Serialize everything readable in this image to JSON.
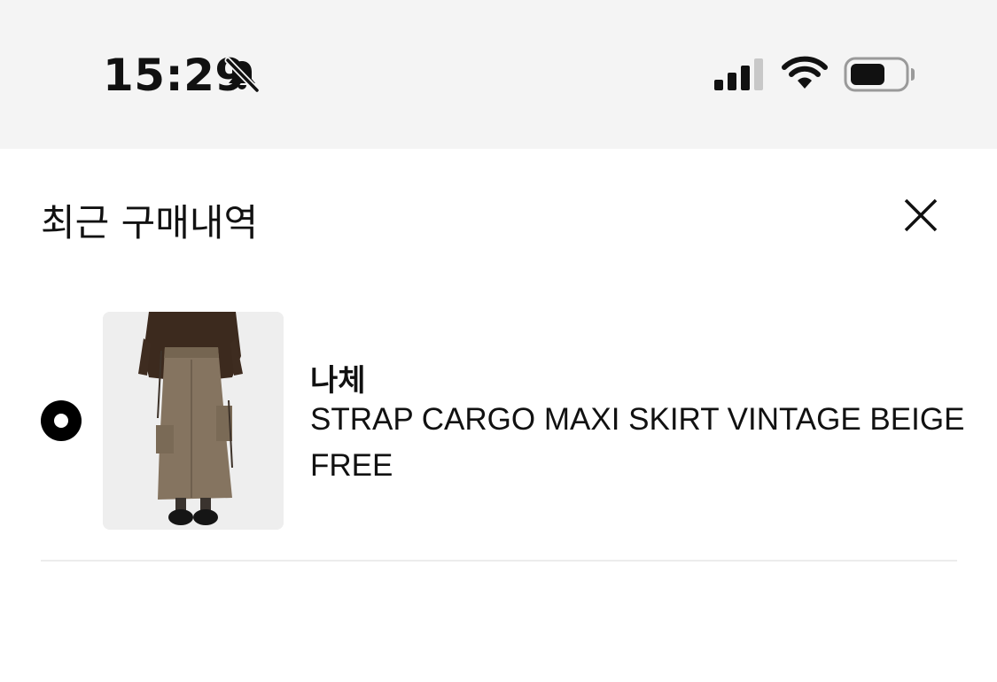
{
  "status_bar": {
    "time": "15:29",
    "icons": [
      "bell-slash-icon",
      "cellular-signal-icon",
      "wifi-icon",
      "battery-icon"
    ]
  },
  "sheet": {
    "title": "최근 구매내역",
    "close_icon": "close-icon"
  },
  "purchases": [
    {
      "selected": true,
      "image": "strap-cargo-maxi-skirt-photo",
      "brand": "나체",
      "name": "STRAP CARGO MAXI SKIRT VINTAGE BEIGE",
      "option": "FREE"
    }
  ],
  "colors": {
    "status_bar_bg": "#f4f4f4",
    "text": "#111111",
    "divider": "#ececec"
  }
}
